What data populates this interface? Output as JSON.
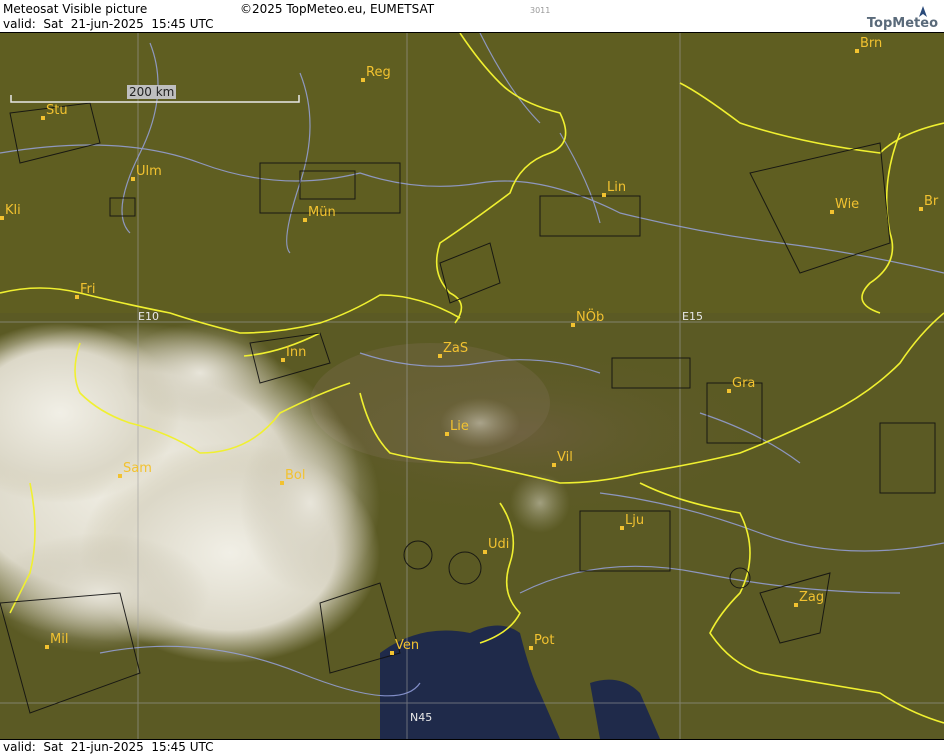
{
  "header": {
    "product": "Meteosat Visible picture",
    "valid": "valid:  Sat  21-jun-2025  15:45 UTC",
    "copyright": "©2025 TopMeteo.eu, EUMETSAT",
    "code": "3011",
    "logo": "TopMeteo"
  },
  "footer": {
    "valid": "valid:  Sat  21-jun-2025  15:45 UTC"
  },
  "scale": {
    "label": "200 km"
  },
  "grid_labels": {
    "lon1": "E10",
    "lon2": "E15",
    "lat": "N45"
  },
  "cities": [
    {
      "code": "Brn"
    },
    {
      "code": "Reg"
    },
    {
      "code": "Stu"
    },
    {
      "code": "Ulm"
    },
    {
      "code": "Lin"
    },
    {
      "code": "Mün"
    },
    {
      "code": "Wie"
    },
    {
      "code": "Br"
    },
    {
      "code": "Kli"
    },
    {
      "code": "Fri"
    },
    {
      "code": "NÖb"
    },
    {
      "code": "ZaS"
    },
    {
      "code": "Inn"
    },
    {
      "code": "Gra"
    },
    {
      "code": "Lie"
    },
    {
      "code": "Sam"
    },
    {
      "code": "Bol"
    },
    {
      "code": "Vil"
    },
    {
      "code": "Lju"
    },
    {
      "code": "Udi"
    },
    {
      "code": "Zag"
    },
    {
      "code": "Mil"
    },
    {
      "code": "Ven"
    },
    {
      "code": "Pot"
    }
  ],
  "colors": {
    "land": "#5b5a24",
    "border": "#f0f030",
    "river": "#9aa6e6",
    "sea": "#1f2a4a",
    "label": "#f2c230"
  }
}
